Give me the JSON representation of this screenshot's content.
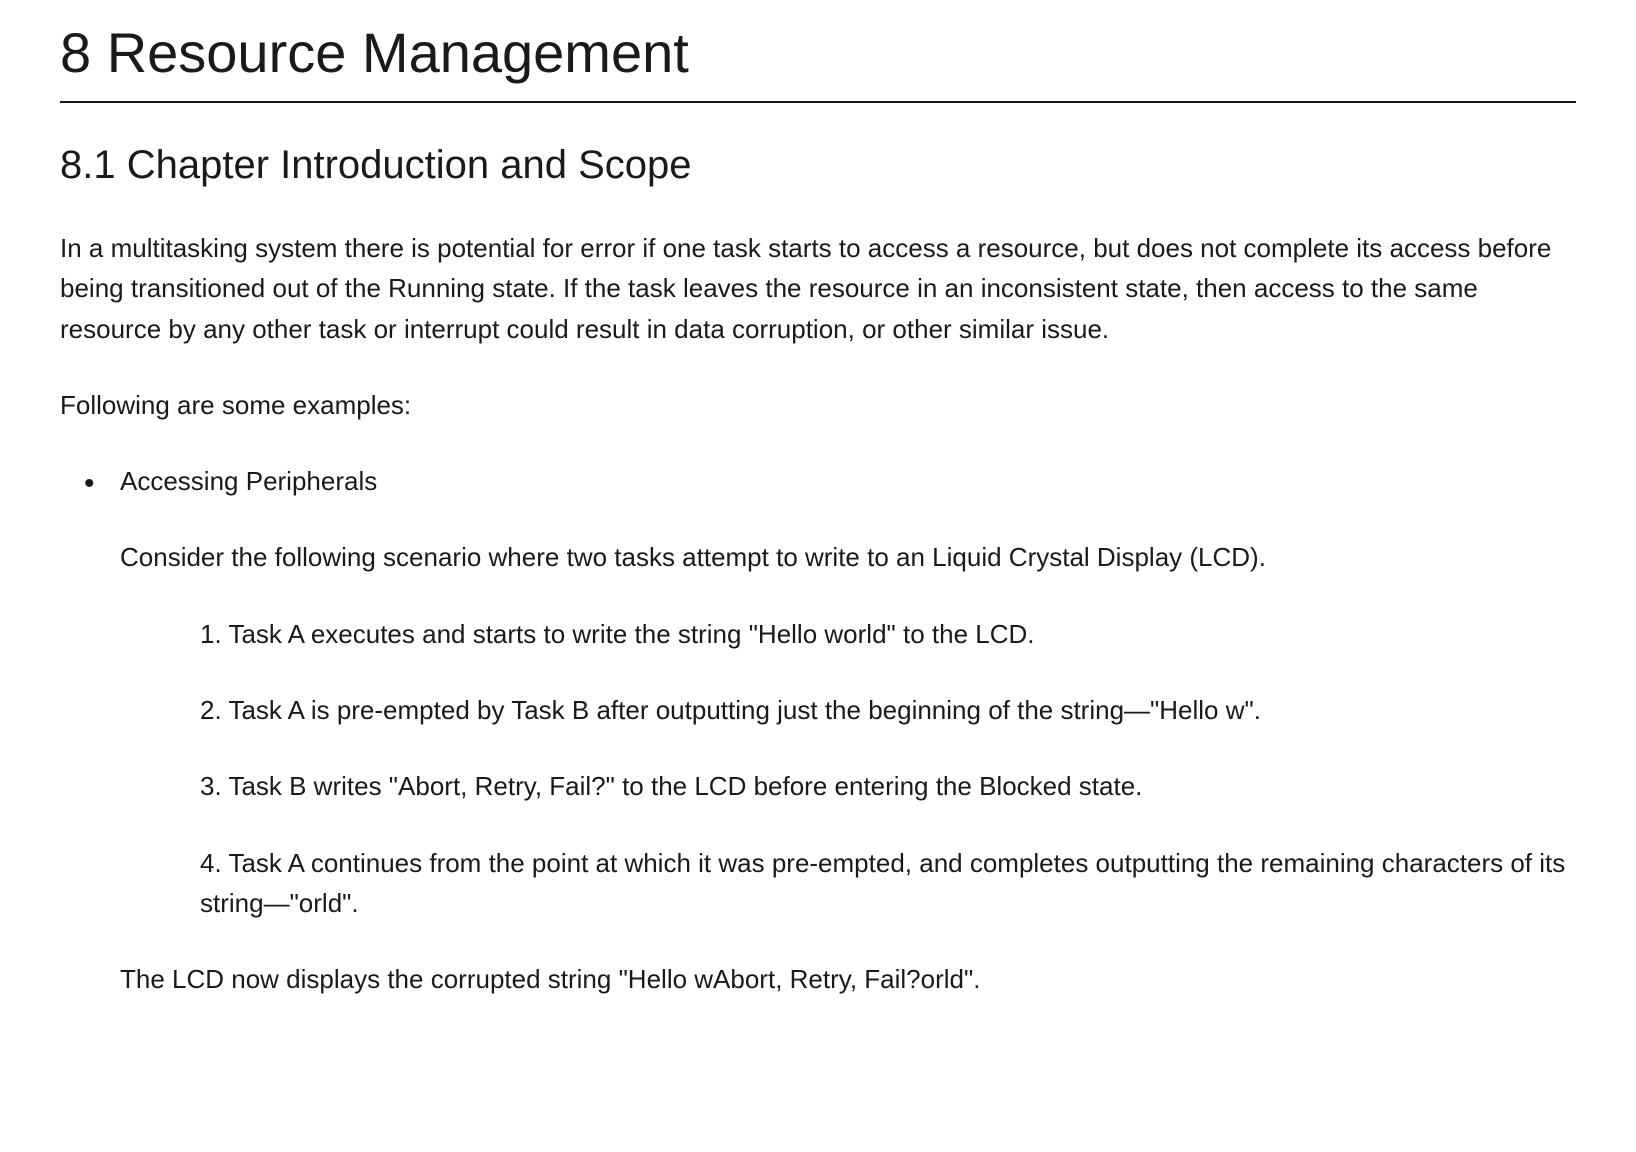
{
  "heading1": "8 Resource Management",
  "heading2": "8.1 Chapter Introduction and Scope",
  "intro_para": "In a multitasking system there is potential for error if one task starts to access a resource, but does not complete its access before being transitioned out of the Running state. If the task leaves the resource in an inconsistent state, then access to the same resource by any other task or interrupt could result in data corruption, or other similar issue.",
  "examples_label": "Following are some examples:",
  "example1": {
    "title": "Accessing Peripherals",
    "desc": "Consider the following scenario where two tasks attempt to write to an Liquid Crystal Display (LCD).",
    "steps": [
      "Task A executes and starts to write the string \"Hello world\" to the LCD.",
      "Task A is pre-empted by Task B after outputting just the beginning of the string—\"Hello w\".",
      "Task B writes \"Abort, Retry, Fail?\" to the LCD before entering the Blocked state.",
      "Task A continues from the point at which it was pre-empted, and completes outputting the remaining characters of its string—\"orld\"."
    ],
    "steps_prefix": [
      "1. ",
      "2. ",
      "3. ",
      "4. "
    ],
    "result": "The LCD now displays the corrupted string \"Hello wAbort, Retry, Fail?orld\"."
  }
}
